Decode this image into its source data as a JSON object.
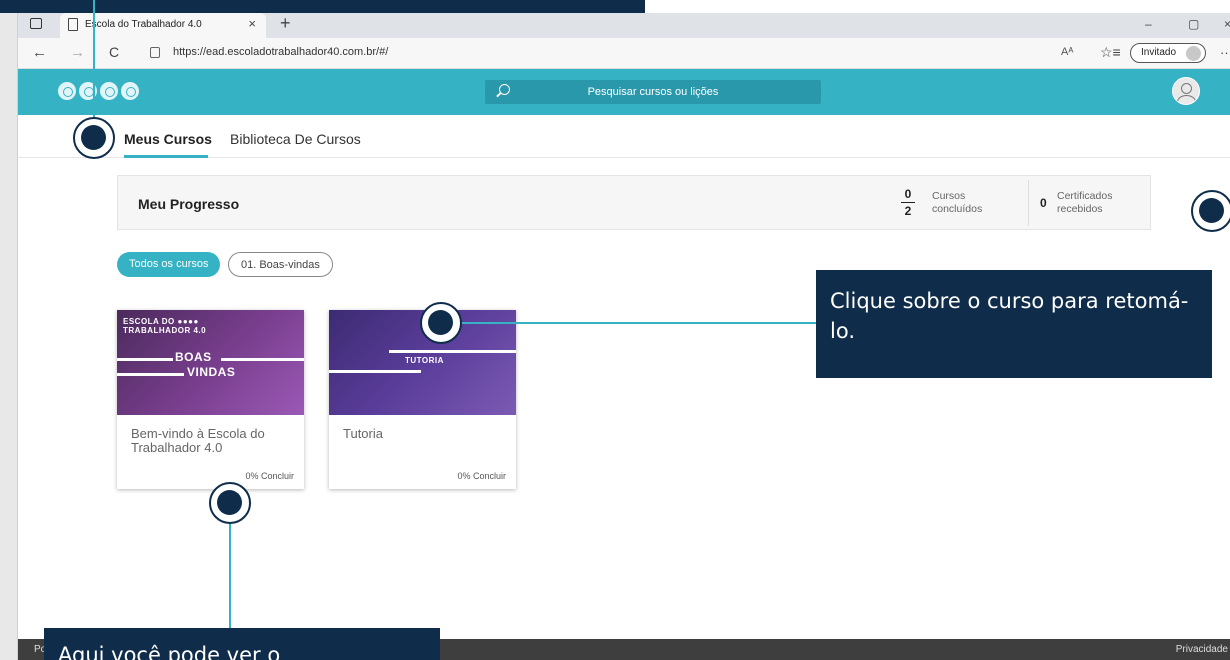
{
  "browser": {
    "tab_title": "Escola do Trabalhador 4.0",
    "tab_close": "×",
    "new_tab": "+",
    "url": "https://ead.escoladotrabalhador40.com.br/#/",
    "read_aloud": "Aᴬ",
    "favorites_icon": "☆≡",
    "profile_label": "Invitado",
    "back": "←",
    "forward": "→",
    "refresh": "C",
    "more": "···",
    "minimize": "–",
    "restore": "▢",
    "close": "×"
  },
  "header": {
    "search_placeholder": "Pesquisar cursos ou lições"
  },
  "nav": {
    "tabs": [
      {
        "label": "Meus Cursos"
      },
      {
        "label": "Biblioteca De Cursos"
      }
    ]
  },
  "progress": {
    "title": "Meu Progresso",
    "courses_completed": "0",
    "courses_total": "2",
    "courses_label_1": "Cursos",
    "courses_label_2": "concluídos",
    "certificates": "0",
    "certificates_label_1": "Certificados",
    "certificates_label_2": "recebidos"
  },
  "filters": [
    {
      "label": "Todos os cursos"
    },
    {
      "label": "01. Boas-vindas"
    }
  ],
  "courses": [
    {
      "title": "Bem-vindo à Escola do Trabalhador 4.0",
      "progress": "0% Concluir",
      "thumb_brand_1": "ESCOLA DO ●●●●",
      "thumb_brand_2": "TRABALHADOR 4.0",
      "thumb_line_1": "BOAS",
      "thumb_line_2": "VINDAS"
    },
    {
      "title": "Tutoria",
      "progress": "0% Concluir",
      "thumb_line_1": "TUTORIA"
    }
  ],
  "footer": {
    "left": "Po",
    "right": "Privacidade"
  },
  "callouts": {
    "resume": "Clique sobre o curso para retomá-lo.",
    "progress": "Aqui você pode ver o"
  },
  "colors": {
    "accent": "#35b3c5",
    "callout_bg": "#0f2d4a"
  }
}
